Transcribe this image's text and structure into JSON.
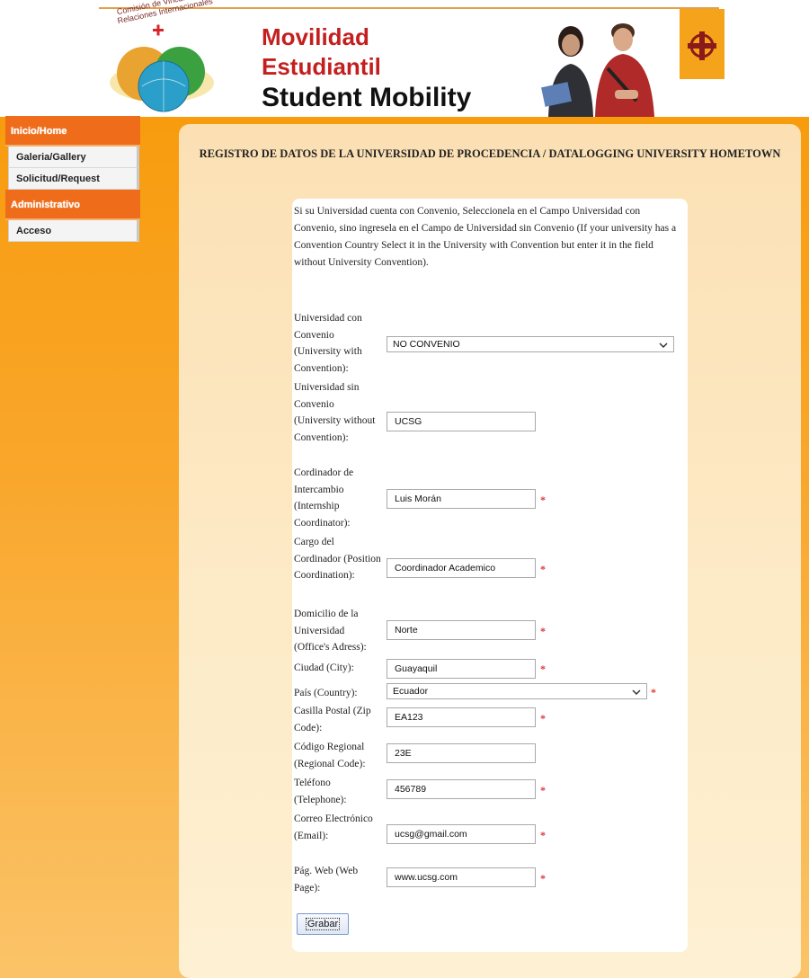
{
  "header": {
    "logo_text_line1": "Comisión de Vinculación y",
    "logo_text_line2": "Relaciones Internacionales",
    "title_line1": "Movilidad",
    "title_line2": "Estudiantil",
    "title_line3": "Student Mobility"
  },
  "menu": {
    "section1": "Inicio/Home",
    "items1": [
      "Galeria/Gallery",
      "Solicitud/Request"
    ],
    "section2": "Administrativo",
    "items2": [
      "Acceso"
    ]
  },
  "page_title": "REGISTRO DE DATOS DE LA UNIVERSIDAD DE PROCEDENCIA / DATALOGGING UNIVERSITY HOMETOWN",
  "intro": "Si su Universidad cuenta con Convenio, Seleccionela en el Campo Universidad con Convenio, sino ingresela en el Campo de Universidad sin Convenio (If your university has a Convention Country Select it in the University with Convention but enter it in the field without University Convention).",
  "form": {
    "univ_con": {
      "label": "Universidad con Convenio (University with Convention):",
      "value": "NO CONVENIO"
    },
    "univ_sin": {
      "label": "Universidad sin Convenio (University without Convention):",
      "value": "UCSG"
    },
    "coordinador": {
      "label": "Cordinador de Intercambio (Internship Coordinator):",
      "value": "Luis Morán"
    },
    "cargo": {
      "label": "Cargo del Cordinador (Position Coordination):",
      "value": "Coordinador Academico"
    },
    "domicilio": {
      "label": "Domicilio de la Universidad (Office's Adress):",
      "value": "Norte"
    },
    "ciudad": {
      "label": "Ciudad (City):",
      "value": "Guayaquil"
    },
    "pais": {
      "label": "País (Country):",
      "value": "Ecuador"
    },
    "casilla": {
      "label": "Casilla Postal (Zip Code):",
      "value": "EA123"
    },
    "codigo": {
      "label": "Código Regional (Regional Code):",
      "value": "23E"
    },
    "telefono": {
      "label": "Teléfono (Telephone):",
      "value": "456789"
    },
    "correo": {
      "label": "Correo Electrónico (Email):",
      "value": "ucsg@gmail.com"
    },
    "web": {
      "label": "Pág. Web (Web Page):",
      "value": "www.ucsg.com"
    },
    "required_mark": "*",
    "save_label": "Grabar"
  },
  "colors": {
    "brand_red": "#c41f1f",
    "menu_orange": "#ef6d1a",
    "background_orange": "#f89c0e",
    "required_red": "#e03a3a"
  }
}
